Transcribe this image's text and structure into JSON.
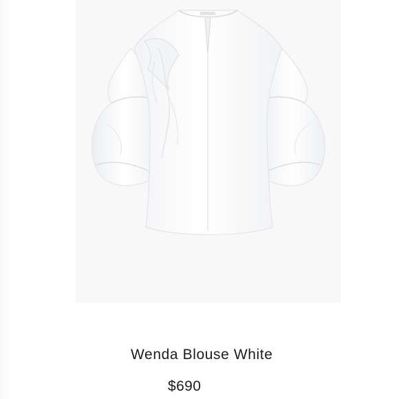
{
  "product": {
    "name": "Wenda Blouse White",
    "price": "$690",
    "image_subject": "white-blouse-photo"
  },
  "colors": {
    "background": "#ffffff",
    "photo_background": "#f8f8f9",
    "text": "#1c1c1c",
    "garment": "#ffffff",
    "garment_shadow": "#e6e7e9"
  }
}
